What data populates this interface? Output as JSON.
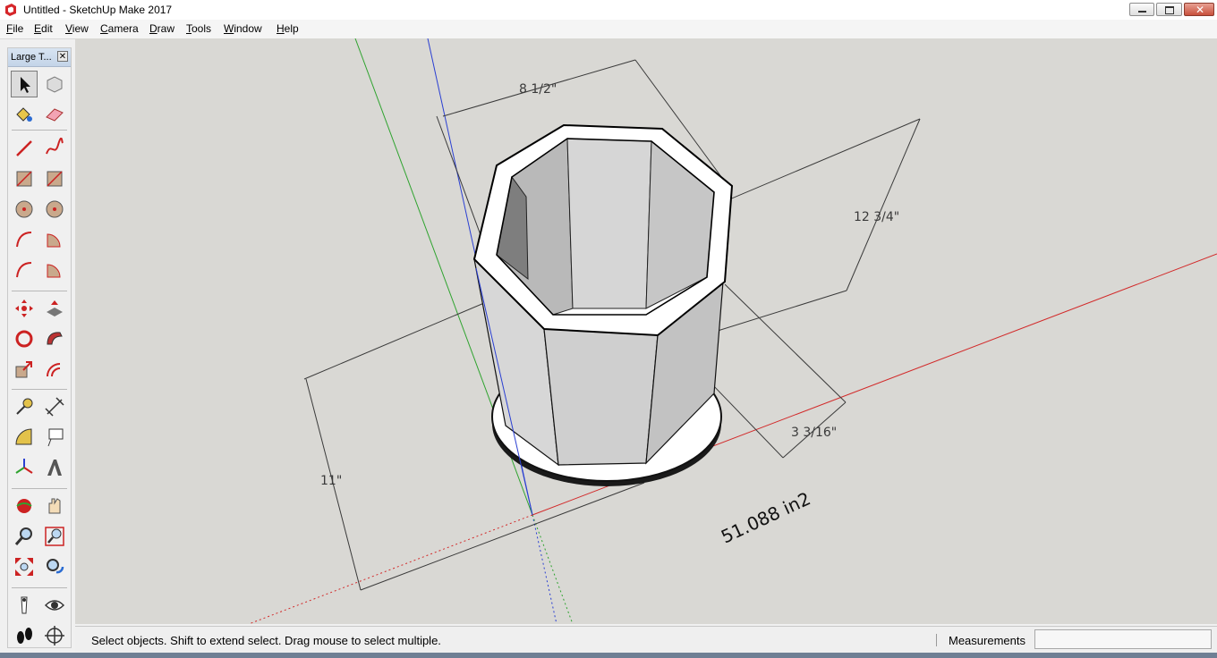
{
  "window": {
    "title": "Untitled - SketchUp Make 2017"
  },
  "menu": {
    "items": [
      {
        "first": "F",
        "rest": "ile"
      },
      {
        "first": "E",
        "rest": "dit"
      },
      {
        "first": "V",
        "rest": "iew"
      },
      {
        "first": "C",
        "rest": "amera"
      },
      {
        "first": "D",
        "rest": "raw"
      },
      {
        "first": "T",
        "rest": "ools"
      },
      {
        "first": "W",
        "rest": "indow"
      },
      {
        "first": "H",
        "rest": "elp"
      }
    ]
  },
  "toolbar": {
    "title": "Large T...",
    "close_glyph": "✕",
    "tools": [
      "select",
      "component",
      "paint-bucket",
      "eraser",
      "line",
      "freehand",
      "rectangle",
      "rotated-rectangle",
      "circle",
      "polygon",
      "arc",
      "pie",
      "two-point-arc",
      "three-point-arc",
      "move",
      "push-pull",
      "rotate",
      "follow-me",
      "scale",
      "offset",
      "tape-measure",
      "dimension",
      "protractor",
      "text",
      "axes",
      "3d-text",
      "orbit",
      "pan",
      "zoom",
      "zoom-window",
      "zoom-extents",
      "previous-view",
      "position-camera",
      "look-around",
      "walk",
      "section-plane"
    ],
    "active_tool": "select"
  },
  "model": {
    "dimensions": {
      "top_width": "8 1/2\"",
      "depth": "12 3/4\"",
      "wall": "3 3/16\"",
      "height": "11\""
    },
    "area_label": "51.088 in2"
  },
  "status": {
    "hint": "Select objects. Shift to extend select. Drag mouse to select multiple.",
    "measurements_label": "Measurements",
    "measurements_value": ""
  },
  "colors": {
    "viewport_bg": "#d9d8d4",
    "axis_red": "#d22a2a",
    "axis_green": "#2fa32f",
    "axis_blue": "#2a3fd2"
  }
}
